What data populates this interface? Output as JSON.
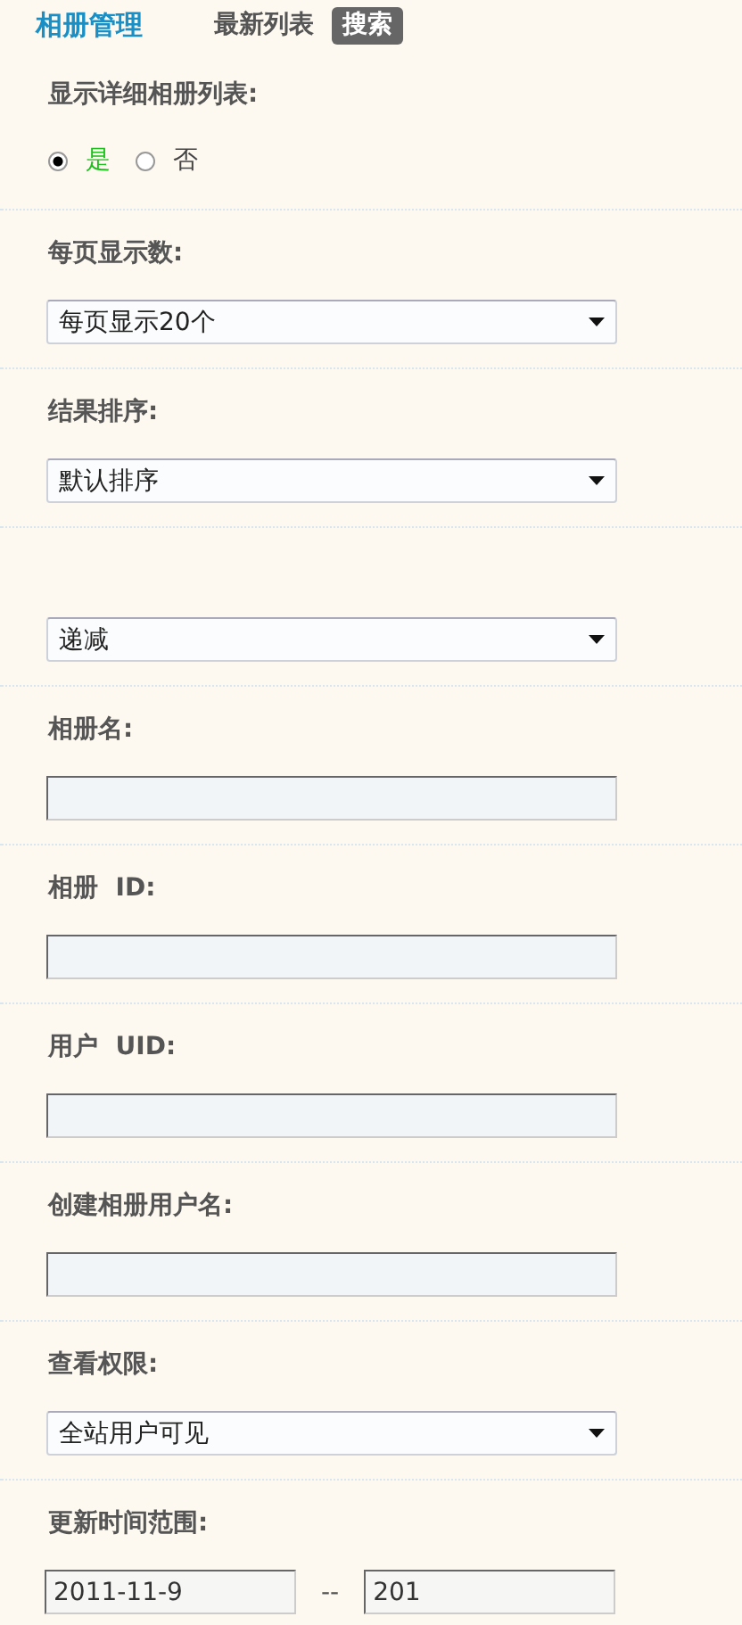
{
  "tabs": [
    {
      "label": "相册管理",
      "kind": "title"
    },
    {
      "label": "最新列表",
      "kind": "tab",
      "selected": false
    },
    {
      "label": "搜索",
      "kind": "tab",
      "selected": true
    }
  ],
  "fields": [
    {
      "kind": "radio",
      "label": "显示详细相册列表:",
      "options": [
        {
          "label": "是",
          "selected": true
        },
        {
          "label": "否",
          "selected": false
        }
      ]
    },
    {
      "kind": "select",
      "label": "每页显示数:",
      "value": "每页显示20个"
    },
    {
      "kind": "select",
      "label": "结果排序:",
      "value": "默认排序"
    },
    {
      "kind": "select",
      "value": "递减"
    },
    {
      "kind": "text",
      "label": "相册名:"
    },
    {
      "kind": "text",
      "label": "相册  ID:"
    },
    {
      "kind": "text",
      "label": "用户  UID:"
    },
    {
      "kind": "text",
      "label": "创建相册用户名:"
    },
    {
      "kind": "select",
      "label": "查看权限:",
      "value": "全站用户可见"
    },
    {
      "kind": "daterange",
      "label": "更新时间范围:",
      "from": "2011-11-9",
      "separator": "--",
      "to": "201"
    }
  ]
}
